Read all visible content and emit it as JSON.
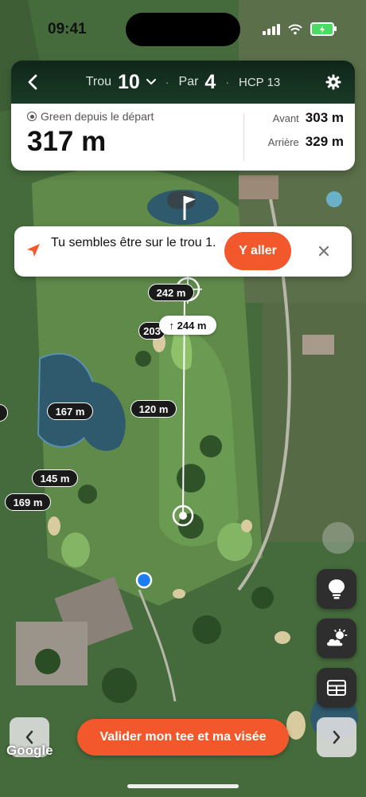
{
  "status_bar": {
    "time": "09:41"
  },
  "hole": {
    "hole_label": "Trou",
    "hole_number": "10",
    "par_label": "Par",
    "par_value": "4",
    "handicap": "HCP 13"
  },
  "distance": {
    "label": "Green depuis le départ",
    "value": "317 m",
    "front_label": "Avant",
    "front_value": "303 m",
    "back_label": "Arrière",
    "back_value": "329 m"
  },
  "banner": {
    "message": "Tu sembles être sur le trou 1.",
    "action_label": "Y aller"
  },
  "map": {
    "target_distance": "242 m",
    "partial_distance": "203",
    "shot_distance": "↑ 244 m",
    "markers": [
      "167 m",
      "120 m",
      "145 m",
      "169 m"
    ],
    "watermark": "Google"
  },
  "bottom": {
    "validate_label": "Valider mon tee et ma visée"
  },
  "colors": {
    "accent": "#f2582b",
    "header": "#1b3a27"
  },
  "icons": [
    "back-icon",
    "chevron-down-icon",
    "gear-icon",
    "navigation-arrow-icon",
    "close-icon",
    "flag-icon",
    "lightbulb-icon",
    "weather-icon",
    "grid-icon",
    "chevron-left-icon",
    "chevron-right-icon"
  ]
}
